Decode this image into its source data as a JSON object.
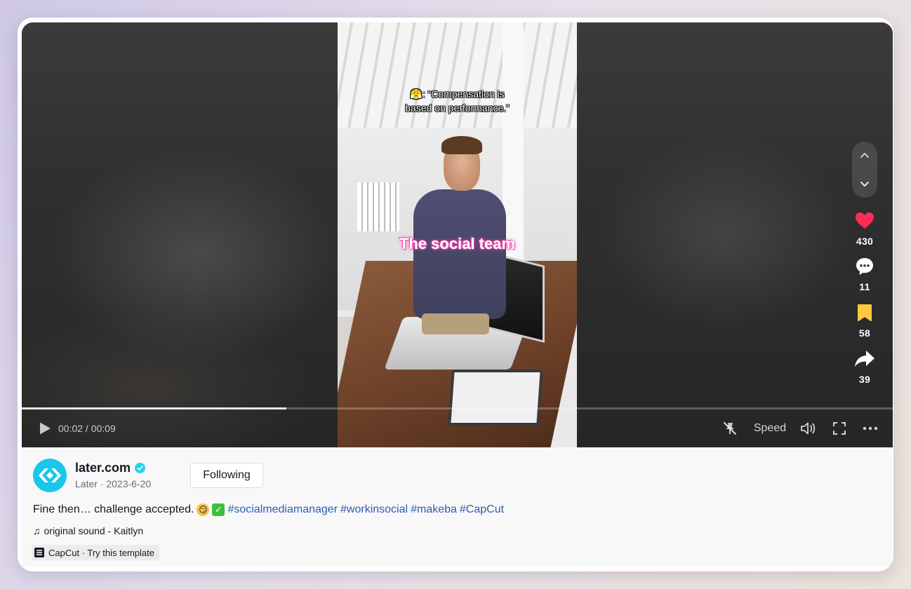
{
  "video": {
    "caption_line1": "😤: “Compensation is",
    "caption_line2": "based on performance.”",
    "overlay_text": "The social team",
    "progress_fraction": 0.304
  },
  "controls": {
    "time": "00:02 / 00:09",
    "speed_label": "Speed"
  },
  "actions": {
    "likes": "430",
    "comments": "11",
    "saves": "58",
    "shares": "39"
  },
  "author": {
    "name": "later.com",
    "subtitle": "Later · 2023-6-20",
    "follow_label": "Following"
  },
  "description": {
    "text": "Fine then… challenge accepted.",
    "hashtags": [
      "#socialmediamanager",
      "#workinsocial",
      "#makeba",
      "#CapCut"
    ]
  },
  "sound": "original sound - Kaitlyn",
  "template": "CapCut · Try this template",
  "colors": {
    "like": "#fe2c55",
    "save": "#ffc83d",
    "hashtag": "#2b5db4",
    "avatar": "#1ac7ea",
    "verified": "#20d5ec"
  }
}
